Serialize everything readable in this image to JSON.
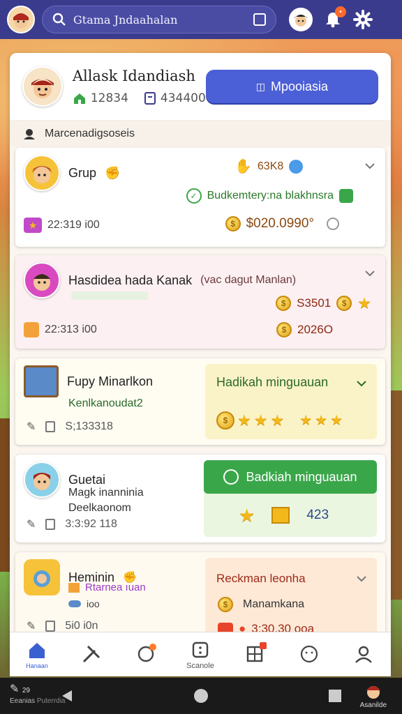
{
  "topbar": {
    "search_text": "Gtama Jndaahalan"
  },
  "profile": {
    "name": "Allask Idandiash",
    "stat1": "12834",
    "stat2": "434400",
    "primary_button": "Mpooiasia"
  },
  "section": {
    "title": "Marcenadigsoseis"
  },
  "items": [
    {
      "title": "Grup",
      "badge_value": "63K8",
      "subtitle": "Budkemtery:na blakhnsra",
      "time": "22:319 i00",
      "amount": "$020.0990°"
    },
    {
      "title": "Hasdidea hada Kanak",
      "suffix": "(vac dagut Manlan)",
      "value1": "S3501",
      "time": "22:313 i00",
      "value2": "2026O"
    },
    {
      "title": "Fupy Minarlkon",
      "subtitle": "Kenlkanoudat2",
      "time": "S;133318",
      "panel_title": "Hadikah minguauan"
    },
    {
      "title": "Guetai",
      "line1": "Magk inanninia",
      "line2": "Deelkaonom",
      "time": "3:3:92 118",
      "panel_button": "Badkiah minguauan",
      "panel_value": "423"
    },
    {
      "title": "Heminin",
      "subtitle": "Rtarnea  ıuan",
      "small": "ioo",
      "time": "5i0 i0n",
      "panel_title": "Reckman  leonha",
      "panel_line": "Manamkana",
      "panel_time": "3:30.30 ooa"
    }
  ],
  "tabs": [
    {
      "label": "Hanaan"
    },
    {
      "label": ""
    },
    {
      "label": ""
    },
    {
      "label": "Scanole"
    },
    {
      "label": ""
    },
    {
      "label": ""
    },
    {
      "label": ""
    }
  ],
  "sysnav": {
    "left1": "Eeanias",
    "left2": "Puterrdia",
    "right": "Asanilde",
    "count": "29"
  },
  "colors": {
    "topbar": "#3a3b8c",
    "primary": "#4b5fd6",
    "green": "#3aa64a",
    "gold": "#f3b81c"
  }
}
